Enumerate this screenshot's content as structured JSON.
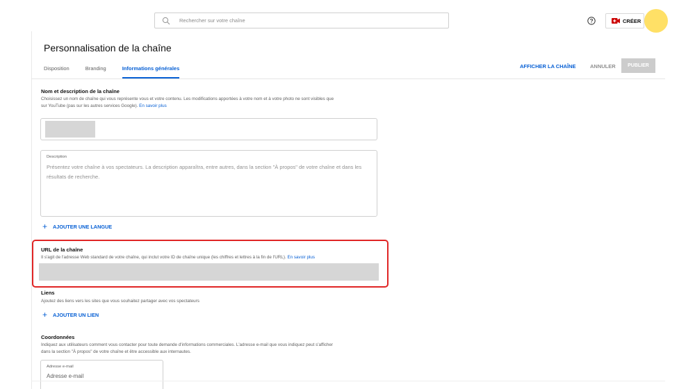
{
  "topbar": {
    "search_placeholder": "Rechercher sur votre chaîne",
    "create_label": "CRÉER",
    "avatar_color": "#ffe066"
  },
  "header": {
    "title": "Personnalisation de la chaîne",
    "tabs": [
      {
        "label": "Disposition",
        "active": false
      },
      {
        "label": "Branding",
        "active": false
      },
      {
        "label": "Informations générales",
        "active": true
      }
    ],
    "view_channel_label": "AFFICHER LA CHAÎNE",
    "cancel_label": "ANNULER",
    "publish_label": "PUBLIER"
  },
  "name_section": {
    "title": "Nom et description de la chaîne",
    "description_line1": "Choisissez un nom de chaîne qui vous représente vous et votre contenu. Les modifications apportées à votre nom et à votre photo ne sont visibles que",
    "description_line2": "sur YouTube (pas sur les autres services Google).",
    "learn_more": "En savoir plus"
  },
  "description_field": {
    "label": "Description",
    "placeholder": "Présentez votre chaîne à vos spectateurs. La description apparaîtra, entre autres, dans la section \"À propos\" de votre chaîne et dans les résultats de recherche."
  },
  "add_language_label": "AJOUTER UNE LANGUE",
  "url_section": {
    "title": "URL de la chaîne",
    "description": "Il s'agit de l'adresse Web standard de votre chaîne, qui inclut votre ID de chaîne unique (les chiffres et lettres à la fin de l'URL).",
    "learn_more": "En savoir plus"
  },
  "links_section": {
    "title": "Liens",
    "description": "Ajoutez des liens vers les sites que vous souhaitez partager avec vos spectateurs",
    "add_link_label": "AJOUTER UN LIEN"
  },
  "contact_section": {
    "title": "Coordonnées",
    "description_line1": "Indiquez aux utilisateurs comment vous contacter pour toute demande d'informations commerciales. L'adresse e-mail que vous indiquez peut s'afficher",
    "description_line2": "dans la section \"À propos\" de votre chaîne et être accessible aux internautes.",
    "email_label": "Adresse e-mail",
    "email_placeholder": "Adresse e-mail"
  },
  "colors": {
    "accent": "#065fd4",
    "highlight_border": "#e02424",
    "create_icon": "#cc0000"
  }
}
